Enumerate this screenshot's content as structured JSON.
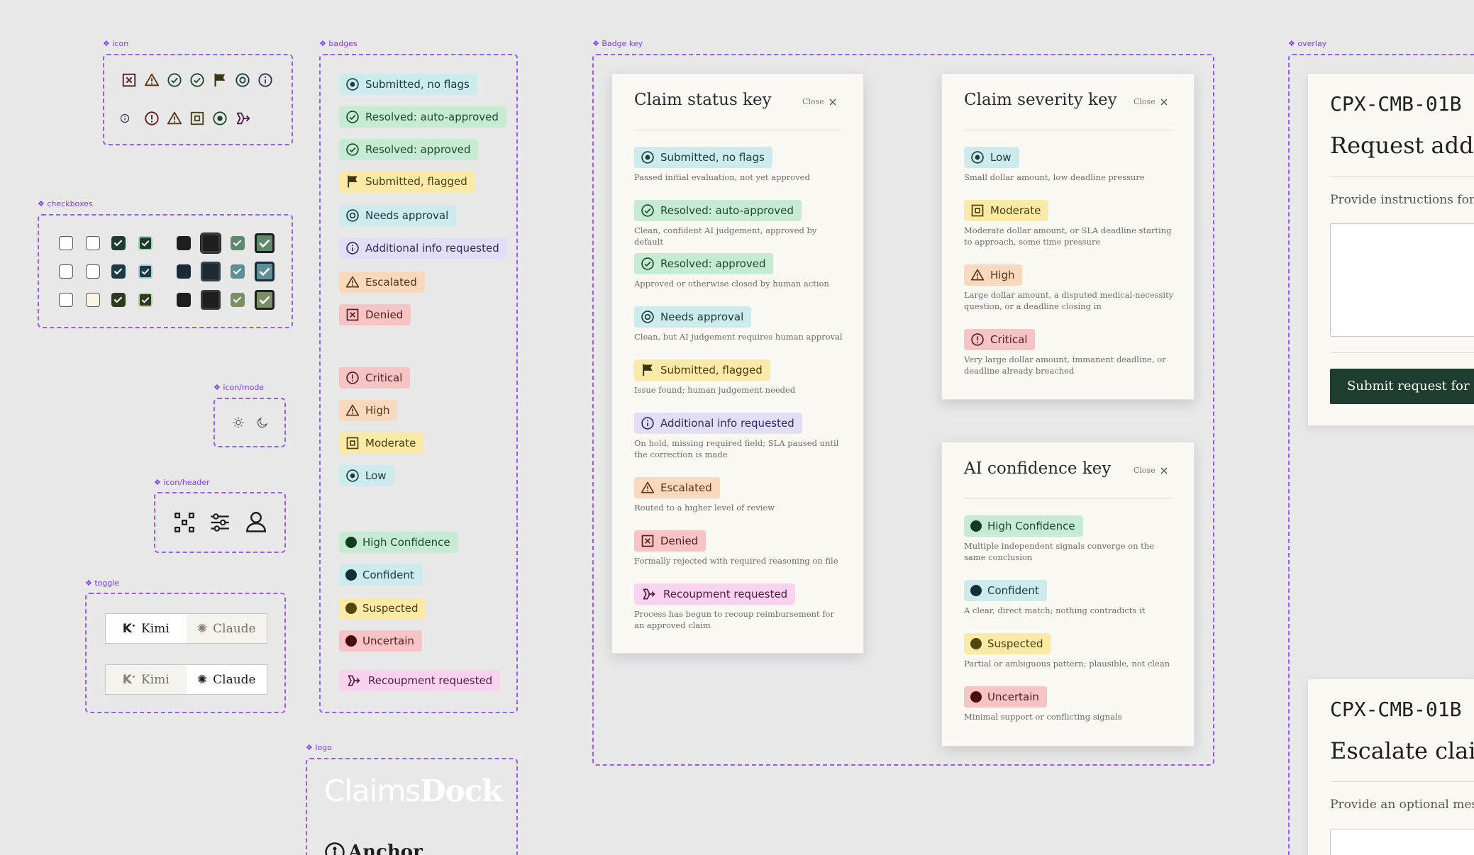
{
  "component_labels": {
    "icon": "icon",
    "badges": "badges",
    "badge_key": "Badge key",
    "overlay": "overlay",
    "checkboxes": "checkboxes",
    "icon_mode": "icon/mode",
    "icon_header": "icon/header",
    "toggle": "toggle",
    "logo": "logo"
  },
  "badges": {
    "status": [
      "Submitted, no flags",
      "Resolved: auto-approved",
      "Resolved: approved",
      "Submitted, flagged",
      "Needs approval",
      "Additional info requested",
      "Escalated",
      "Denied"
    ],
    "severity": [
      "Critical",
      "High",
      "Moderate",
      "Low"
    ],
    "confidence": [
      "High Confidence",
      "Confident",
      "Suspected",
      "Uncertain"
    ],
    "recoupment": "Recoupment requested"
  },
  "toggle": {
    "kimi": "Kimi",
    "claude": "Claude"
  },
  "logo": {
    "claims_light": "Claims",
    "claims_bold": "Dock",
    "anchor": "Anchor"
  },
  "modals": {
    "close_label": "Close",
    "status": {
      "title": "Claim status key",
      "items": [
        {
          "label": "Submitted, no flags",
          "desc": "Passed initial evaluation, not yet approved"
        },
        {
          "label": "Resolved: auto-approved",
          "desc": "Clean, confident AI judgement, approved by default"
        },
        {
          "label": "Resolved: approved",
          "desc": "Approved or otherwise closed by human action"
        },
        {
          "label": "Needs approval",
          "desc": "Clean, but AI judgement requires human approval"
        },
        {
          "label": "Submitted, flagged",
          "desc": "Issue found; human judgement needed"
        },
        {
          "label": "Additional info requested",
          "desc": "On hold, missing required field; SLA paused until the correction is made"
        },
        {
          "label": "Escalated",
          "desc": "Routed to a higher level of review"
        },
        {
          "label": "Denied",
          "desc": "Formally rejected with required reasoning on file"
        },
        {
          "label": "Recoupment requested",
          "desc": "Process has begun to recoup reimbursement for an approved claim"
        }
      ]
    },
    "severity": {
      "title": "Claim severity key",
      "items": [
        {
          "label": "Low",
          "desc": "Small dollar amount, low deadline pressure"
        },
        {
          "label": "Moderate",
          "desc": "Moderate dollar amount, or SLA deadline starting to approach, some time pressure"
        },
        {
          "label": "High",
          "desc": "Large dollar amount, a disputed medical-necessity question, or a deadline closing in"
        },
        {
          "label": "Critical",
          "desc": "Very large dollar amount, immanent deadline, or deadline already breached"
        }
      ]
    },
    "confidence": {
      "title": "AI confidence key",
      "items": [
        {
          "label": "High Confidence",
          "desc": "Multiple independent signals converge on the same conclusion"
        },
        {
          "label": "Confident",
          "desc": "A clear, direct match; nothing contradicts it"
        },
        {
          "label": "Suspected",
          "desc": "Partial or ambiguous pattern; plausible, not clean"
        },
        {
          "label": "Uncertain",
          "desc": "Minimal support or conflicting signals"
        }
      ]
    }
  },
  "overlay": {
    "card1": {
      "claim_id": "CPX-CMB-01B",
      "title": "Request addit",
      "instructions": "Provide instructions for i",
      "button": "Submit request for a"
    },
    "card2": {
      "claim_id": "CPX-CMB-01B",
      "title": "Escalate claim",
      "instructions": "Provide an optional mess"
    }
  },
  "colors": {
    "frame_border": "#9b5cf6",
    "canvas": "#e8e8e9",
    "primary_button": "#1f3d2e",
    "teal_badge": "#cdeaec",
    "green_badge": "#c7ebd2",
    "yellow_badge": "#fbeaa7",
    "lavender_badge": "#e3def8",
    "orange_badge": "#f8d9bd",
    "red_badge": "#f5c4c4",
    "pink_badge": "#f8d2ef"
  },
  "icons": {
    "status": [
      "x-box-icon",
      "triangle-alert-icon",
      "check-circle-icon",
      "flag-icon",
      "target-circle-icon",
      "info-circle-icon"
    ],
    "severity": [
      "exclamation-circle-icon",
      "triangle-alert-icon",
      "target-square-icon",
      "target-circle-icon"
    ],
    "recoupment": "recoup-arrow-icon",
    "mode": [
      "sun-icon",
      "moon-icon"
    ],
    "header": [
      "workflow-icon",
      "sliders-icon",
      "user-icon"
    ]
  }
}
